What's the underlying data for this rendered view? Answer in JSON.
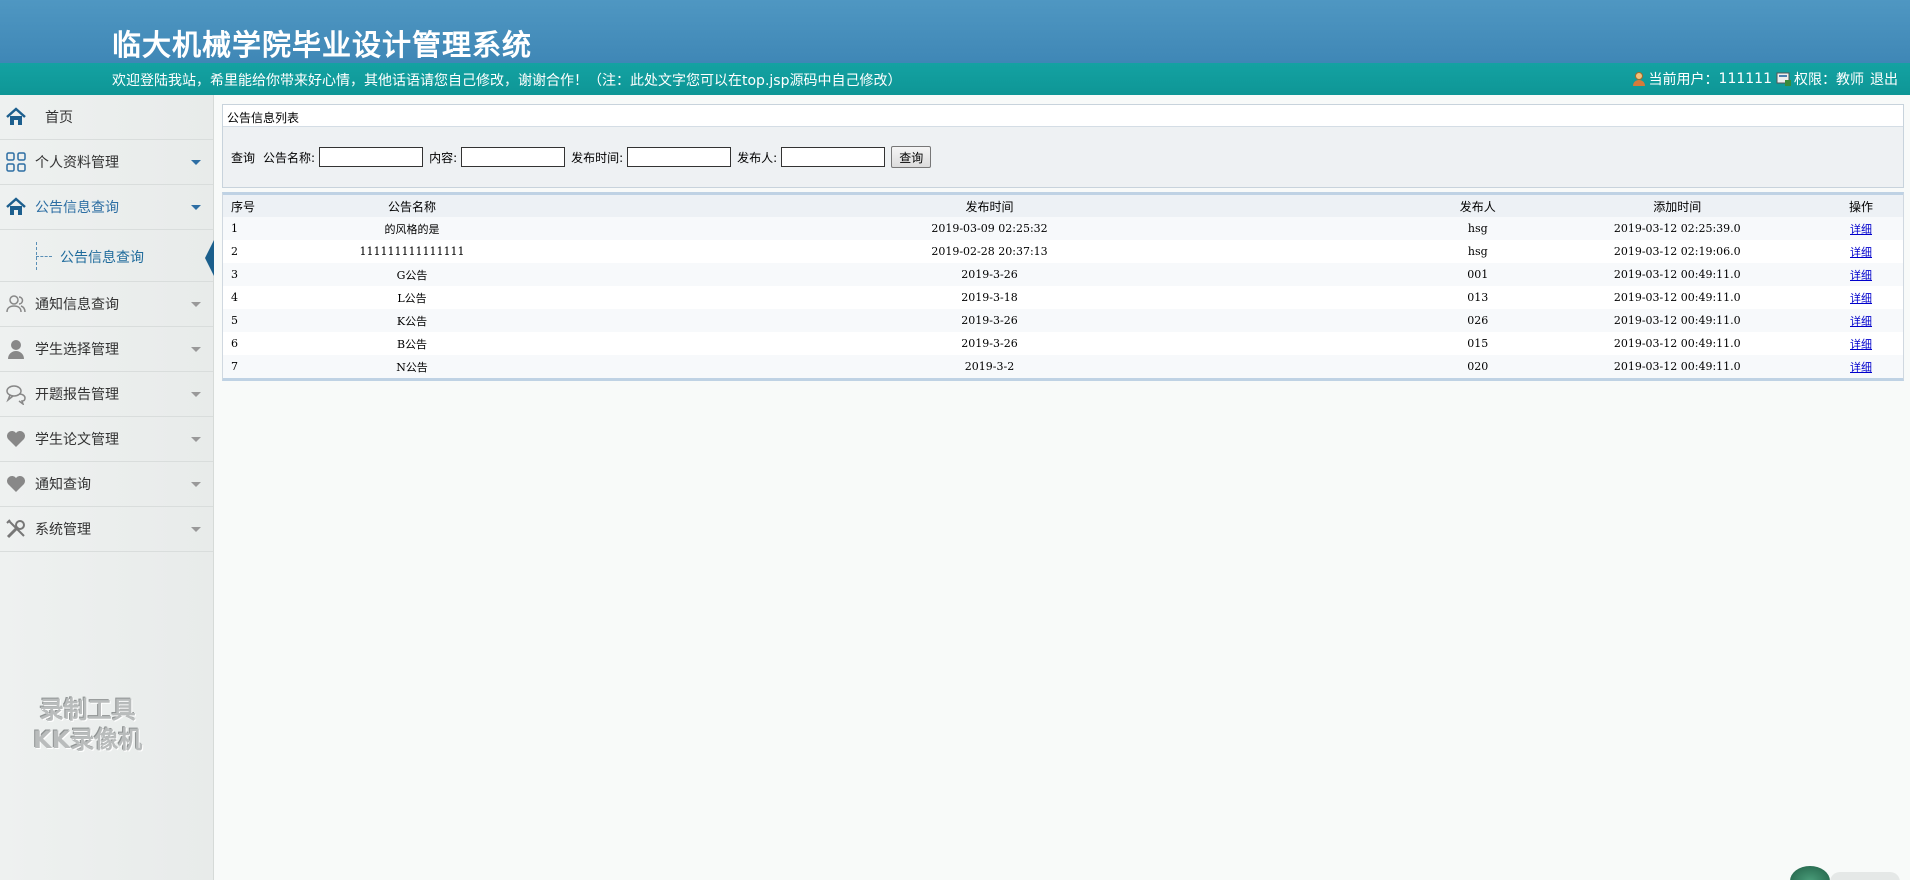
{
  "header": {
    "title": "临大机械学院毕业设计管理系统",
    "welcome": "欢迎登陆我站，希里能给你带来好心情，其他话语请您自己修改，谢谢合作！（注：此处文字您可以在top.jsp源码中自己修改）",
    "current_user_label": "当前用户：",
    "current_user": "111111",
    "permission_label": "权限：",
    "permission": "教师",
    "logout": "退出"
  },
  "sidebar": {
    "items": [
      {
        "label": "首页",
        "icon": "home-icon"
      },
      {
        "label": "个人资料管理",
        "icon": "grid-icon"
      },
      {
        "label": "公告信息查询",
        "icon": "home-icon"
      },
      {
        "label": "通知信息查询",
        "icon": "users-icon"
      },
      {
        "label": "学生选择管理",
        "icon": "user-icon"
      },
      {
        "label": "开题报告管理",
        "icon": "chat-icon"
      },
      {
        "label": "学生论文管理",
        "icon": "heart-icon"
      },
      {
        "label": "通知查询",
        "icon": "heart-icon"
      },
      {
        "label": "系统管理",
        "icon": "tools-icon"
      }
    ],
    "sub_item": "公告信息查询",
    "watermark_line1": "录制工具",
    "watermark_line2": "KK录像机"
  },
  "panel": {
    "title": "公告信息列表",
    "query_label": "查询",
    "name_label": "公告名称:",
    "content_label": "内容:",
    "time_label": "发布时间:",
    "publisher_label": "发布人:",
    "search_button": "查询",
    "name_value": "",
    "content_value": "",
    "time_value": "",
    "publisher_value": ""
  },
  "table": {
    "headers": [
      "序号",
      "公告名称",
      "发布时间",
      "发布人",
      "添加时间",
      "操作"
    ],
    "rows": [
      [
        "1",
        "的风格的是",
        "2019-03-09 02:25:32",
        "hsg",
        "2019-03-12 02:25:39.0",
        "详细"
      ],
      [
        "2",
        "111111111111111",
        "2019-02-28 20:37:13",
        "hsg",
        "2019-03-12 02:19:06.0",
        "详细"
      ],
      [
        "3",
        "G公告",
        "2019-3-26",
        "001",
        "2019-03-12 00:49:11.0",
        "详细"
      ],
      [
        "4",
        "L公告",
        "2019-3-18",
        "013",
        "2019-03-12 00:49:11.0",
        "详细"
      ],
      [
        "5",
        "K公告",
        "2019-3-26",
        "026",
        "2019-03-12 00:49:11.0",
        "详细"
      ],
      [
        "6",
        "B公告",
        "2019-3-26",
        "015",
        "2019-03-12 00:49:11.0",
        "详细"
      ],
      [
        "7",
        "N公告",
        "2019-3-2",
        "020",
        "2019-03-12 00:49:11.0",
        "详细"
      ]
    ]
  }
}
